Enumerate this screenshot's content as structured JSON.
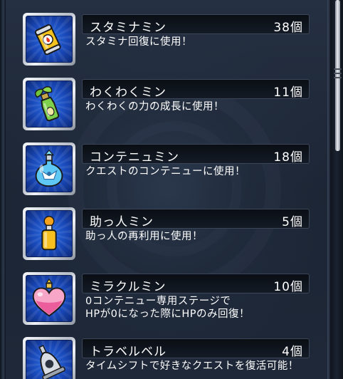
{
  "items": [
    {
      "name": "スタミナミン",
      "count": "38個",
      "description": "スタミナ回復に使用！",
      "icon": "stamina-drink-can-icon"
    },
    {
      "name": "わくわくミン",
      "count": "11個",
      "description": "わくわくの力の成長に使用！",
      "icon": "sprout-bottle-icon"
    },
    {
      "name": "コンテニュミン",
      "count": "18個",
      "description": "クエストのコンテニューに使用！",
      "icon": "blue-potion-flask-icon"
    },
    {
      "name": "助っ人ミン",
      "count": "5個",
      "description": "助っ人の再利用に使用！",
      "icon": "orange-helper-bottle-icon"
    },
    {
      "name": "ミラクルミン",
      "count": "10個",
      "description": "0コンテニュー専用ステージで\nHPが0になった際にHPのみ回復！",
      "icon": "heart-potion-icon"
    },
    {
      "name": "トラベルベル",
      "count": "4個",
      "description": "タイムシフトで好きなクエストを復活可能！",
      "icon": "travel-bell-icon"
    }
  ],
  "colors": {
    "panel_background": "#1e2838",
    "icon_background": "#1948b8",
    "text": "#ffffff"
  }
}
